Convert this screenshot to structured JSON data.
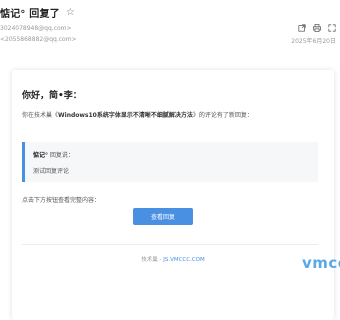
{
  "header": {
    "subject": "惦记° 回复了",
    "from": "3024078948@qq.com>",
    "to": "<2055868882@qq.com>",
    "date": "2025年6月20日"
  },
  "icons": {
    "star": "star-outline-icon",
    "toolbar": [
      "open-external-icon",
      "print-icon",
      "fullscreen-icon"
    ]
  },
  "card": {
    "greeting": "你好，简•李：",
    "para_prefix": "你在技术巢《",
    "article_title": "Windows10系统字体显示不清晰不细腻解决方法",
    "para_suffix": "》的评论有了新回复：",
    "reply_user": "惦记°",
    "reply_verb": " 回复说：",
    "reply_content": "测试回复评论",
    "hint": "点击下方按钮查看完整内容：",
    "button_label": "查看回复",
    "footer_prefix": "技术巢 - ",
    "footer_link": "JS.VMCCC.COM"
  },
  "watermark": "vmcc",
  "colors": {
    "accent": "#4a90e2",
    "watermark": "#5aa9e6"
  }
}
